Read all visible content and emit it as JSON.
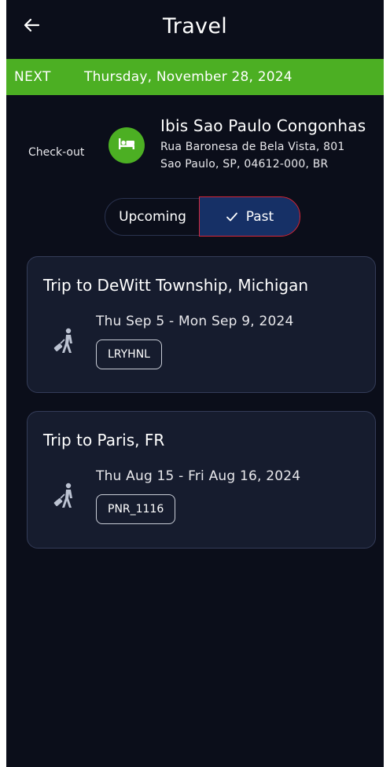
{
  "header": {
    "title": "Travel",
    "back_icon": "arrow-left-icon"
  },
  "next": {
    "label": "NEXT",
    "date": "Thursday, November 28, 2024",
    "color": "#4caf23"
  },
  "hotel": {
    "checkout_label": "Check-out",
    "icon": "bed-icon",
    "name": "Ibis Sao Paulo Congonhas",
    "address_line1": "Rua Baronesa de Bela Vista, 801",
    "address_line2": "Sao Paulo, SP, 04612-000, BR"
  },
  "toggle": {
    "upcoming_label": "Upcoming",
    "past_label": "Past",
    "selected": "Past",
    "selected_color": "#163066"
  },
  "trips": [
    {
      "title": "Trip to DeWitt Township, Michigan",
      "dates": "Thu Sep 5 - Mon Sep 9, 2024",
      "pnr": "LRYHNL",
      "icon": "traveler-luggage-icon"
    },
    {
      "title": "Trip to Paris, FR",
      "dates": "Thu Aug 15 - Fri Aug 16, 2024",
      "pnr": "PNR_1116",
      "icon": "traveler-luggage-icon"
    }
  ],
  "colors": {
    "background": "#0b0e1a",
    "card": "#161c2e",
    "accent_green": "#4caf23"
  }
}
